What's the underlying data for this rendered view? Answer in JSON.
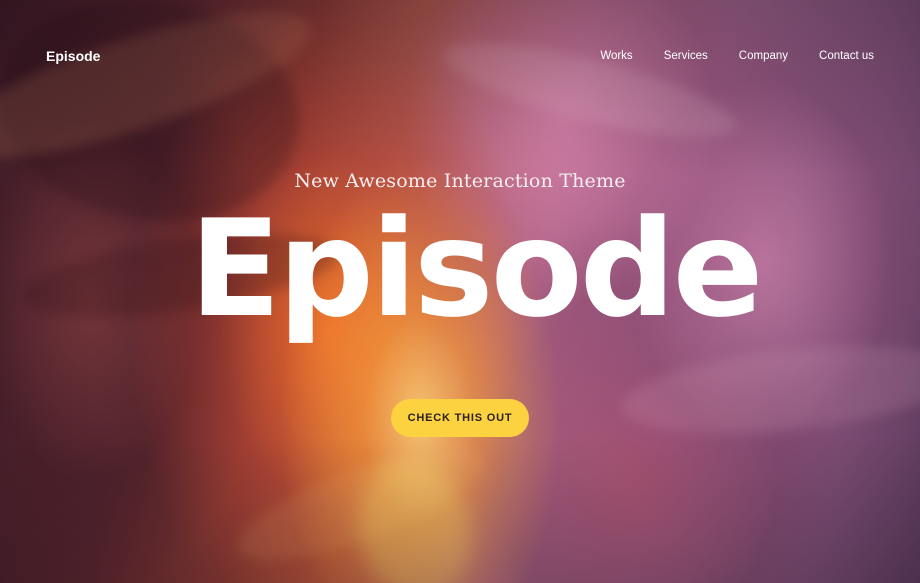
{
  "header": {
    "brand": "Episode",
    "nav": [
      "Works",
      "Services",
      "Company",
      "Contact us"
    ]
  },
  "hero": {
    "subtitle": "New Awesome Interaction Theme",
    "title": "Episode",
    "cta_label": "CHECK THIS OUT"
  },
  "colors": {
    "accent": "#fcd240",
    "text": "#ffffff"
  }
}
